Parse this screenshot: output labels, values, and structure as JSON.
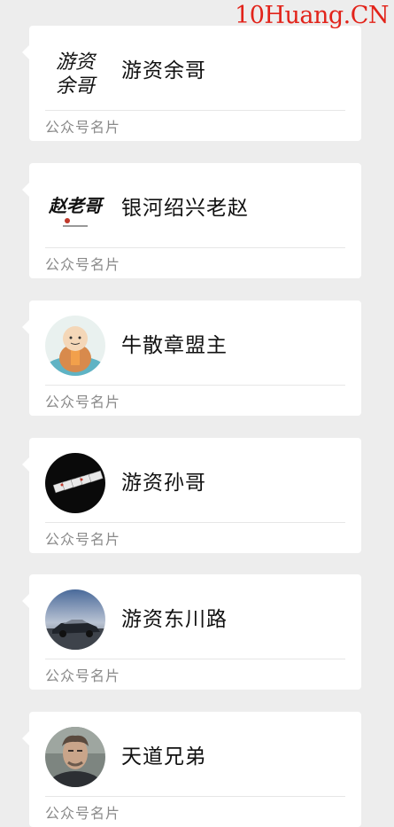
{
  "watermark": "10Huang.CN",
  "cards": [
    {
      "name": "游资余哥",
      "footer": "公众号名片",
      "avatar_icon": "calligraphy-logo-avatar",
      "avatar_text": "游资余哥"
    },
    {
      "name": "银河绍兴老赵",
      "footer": "公众号名片",
      "avatar_icon": "calligraphy-logo-avatar",
      "avatar_text": "赵老哥"
    },
    {
      "name": "牛散章盟主",
      "footer": "公众号名片",
      "avatar_icon": "monk-illustration-avatar"
    },
    {
      "name": "游资孙哥",
      "footer": "公众号名片",
      "avatar_icon": "cards-avatar"
    },
    {
      "name": "游资东川路",
      "footer": "公众号名片",
      "avatar_icon": "car-avatar"
    },
    {
      "name": "天道兄弟",
      "footer": "公众号名片",
      "avatar_icon": "portrait-avatar"
    }
  ]
}
